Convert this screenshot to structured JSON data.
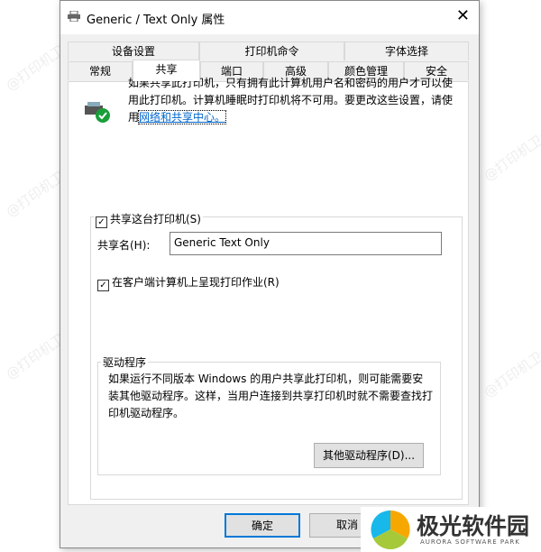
{
  "watermark": "@打印机卫士",
  "dialog": {
    "title": "Generic / Text Only 属性",
    "close": "✕"
  },
  "tabs_row1": [
    "设备设置",
    "打印机命令",
    "字体选择"
  ],
  "tabs_row2": [
    "常规",
    "共享",
    "端口",
    "高级",
    "颜色管理",
    "安全"
  ],
  "active_tab": "共享",
  "info": {
    "text": "如果共享此打印机，只有拥有此计算机用户名和密码的用户才可以使用此打印机。计算机睡眠时打印机将不可用。要更改这些设置，请使用",
    "link": "网络和共享中心。"
  },
  "share": {
    "checkbox_label": "共享这台打印机(S)",
    "checked": true,
    "name_label": "共享名(H):",
    "name_value": "Generic  Text Only",
    "render_label": "在客户端计算机上呈现打印作业(R)",
    "render_checked": true
  },
  "drivers": {
    "title": "驱动程序",
    "text": "如果运行不同版本 Windows 的用户共享此打印机，则可能需要安装其他驱动程序。这样，当用户连接到共享打印机时就不需要查找打印机驱动程序。",
    "button": "其他驱动程序(D)..."
  },
  "buttons": {
    "ok": "确定",
    "cancel": "取消"
  },
  "logo": {
    "name": "极光软件园",
    "sub": "AURORA SOFTWARE PARK"
  }
}
